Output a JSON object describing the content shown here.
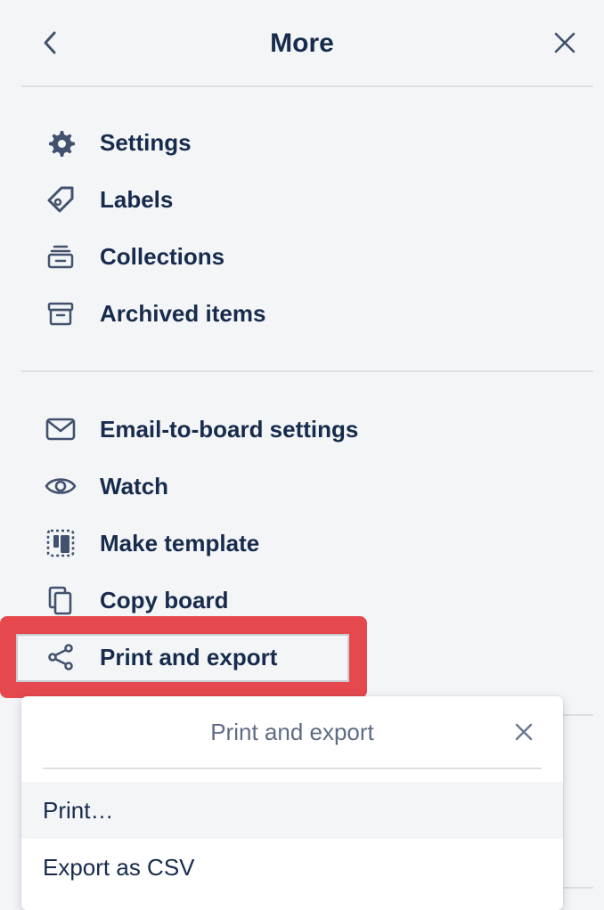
{
  "header": {
    "title": "More",
    "back_icon": "chevron-left-icon",
    "close_icon": "close-icon"
  },
  "sections": [
    {
      "items": [
        {
          "label": "Settings",
          "icon": "gear-icon"
        },
        {
          "label": "Labels",
          "icon": "tag-icon"
        },
        {
          "label": "Collections",
          "icon": "collection-icon"
        },
        {
          "label": "Archived items",
          "icon": "archive-icon"
        }
      ]
    },
    {
      "items": [
        {
          "label": "Email-to-board settings",
          "icon": "envelope-icon"
        },
        {
          "label": "Watch",
          "icon": "eye-icon"
        },
        {
          "label": "Make template",
          "icon": "template-icon"
        },
        {
          "label": "Copy board",
          "icon": "copy-icon"
        },
        {
          "label": "Print and export",
          "icon": "share-icon"
        }
      ]
    }
  ],
  "popover": {
    "title": "Print and export",
    "close_icon": "close-icon",
    "items": [
      {
        "label": "Print…"
      },
      {
        "label": "Export as CSV"
      }
    ]
  },
  "colors": {
    "background": "#f4f5f7",
    "text": "#172b4d",
    "muted_text": "#5e6c84",
    "highlight": "#e5484d",
    "divider": "#dcdfe4"
  }
}
